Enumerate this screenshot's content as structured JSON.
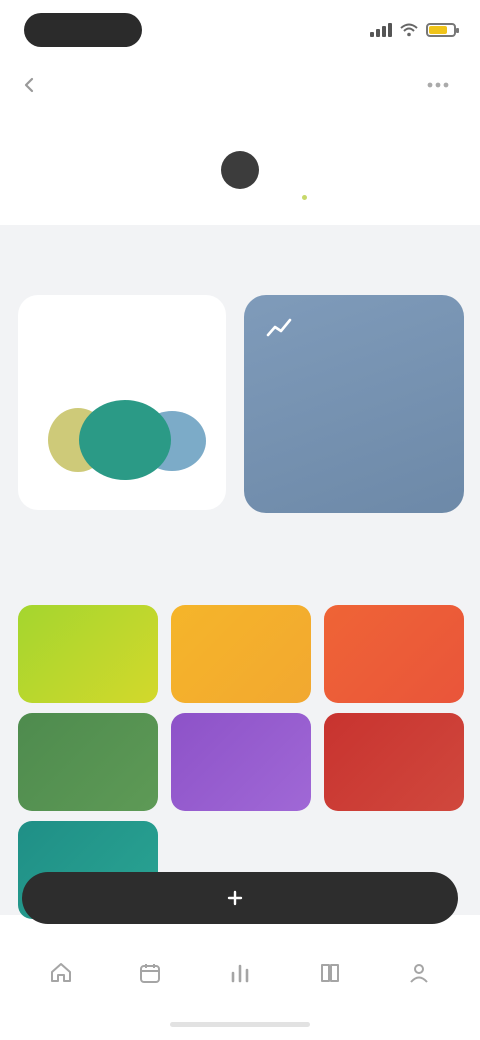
{
  "status_bar": {
    "time": "",
    "battery_color": "#f0c419"
  },
  "header": {
    "title": "",
    "back_label": ""
  },
  "week": [
    {
      "weekday": "",
      "date": "",
      "selected": false
    },
    {
      "weekday": "",
      "date": "",
      "selected": false
    },
    {
      "weekday": "",
      "date": "",
      "selected": false
    },
    {
      "weekday": "",
      "date": "",
      "selected": true
    },
    {
      "weekday": "",
      "date": "",
      "selected": false
    },
    {
      "weekday": "",
      "date": "",
      "selected": false
    },
    {
      "weekday": "",
      "date": "",
      "selected": false
    }
  ],
  "summary_section": {
    "label": ""
  },
  "summary_card": {
    "title": "",
    "blob_colors": [
      "#c9c46a",
      "#2b9a86",
      "#6ea2c2"
    ]
  },
  "stat_card": {
    "icon": "chart-icon",
    "value": "",
    "sub": "",
    "background": "#7a96b5"
  },
  "moods_section": {
    "label": ""
  },
  "moods": [
    {
      "label": "",
      "color": "#a4d62e",
      "color2": "#d3d82c"
    },
    {
      "label": "",
      "color": "#f5b52a",
      "color2": "#f2a830"
    },
    {
      "label": "",
      "color": "#ef6436",
      "color2": "#e9553a"
    },
    {
      "label": "",
      "color": "#4e8b4e",
      "color2": "#5e9a56"
    },
    {
      "label": "",
      "color": "#8d52c8",
      "color2": "#a068d6"
    },
    {
      "label": "",
      "color": "#c8332f",
      "color2": "#d0483d"
    },
    {
      "label": "",
      "color": "#1f8f86",
      "color2": "#2aa493"
    }
  ],
  "action_bar": {
    "label": "",
    "icon": "plus-icon"
  },
  "tabs": [
    {
      "label": "",
      "icon": "home-icon"
    },
    {
      "label": "",
      "icon": "calendar-icon"
    },
    {
      "label": "",
      "icon": "stats-icon"
    },
    {
      "label": "",
      "icon": "book-icon"
    },
    {
      "label": "",
      "icon": "profile-icon"
    }
  ]
}
